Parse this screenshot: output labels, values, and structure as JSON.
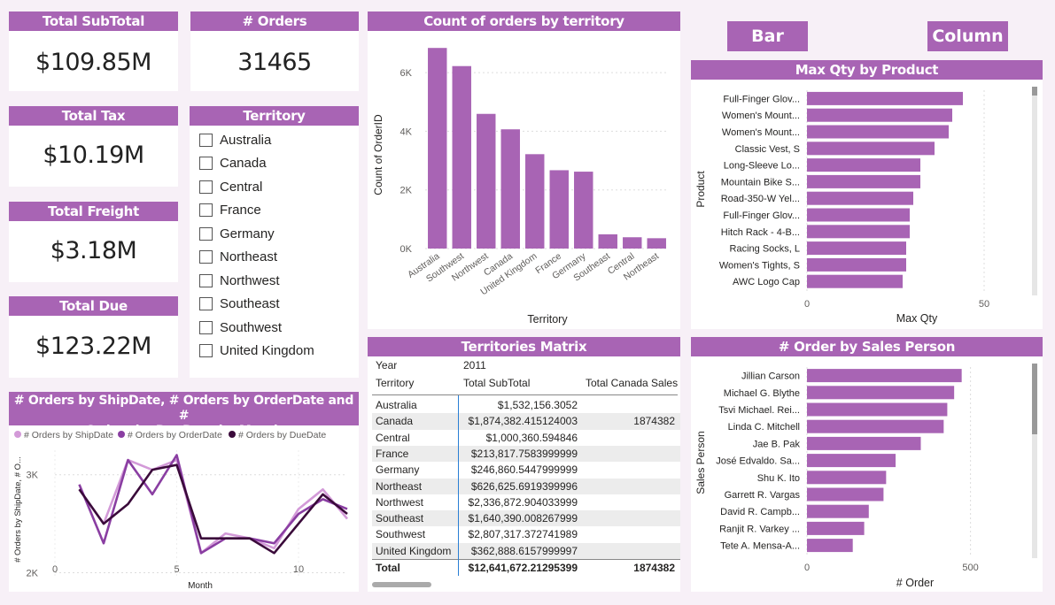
{
  "kpis": {
    "total_subtotal": {
      "title": "Total SubTotal",
      "value": "$109.85M"
    },
    "orders": {
      "title": "# Orders",
      "value": "31465"
    },
    "total_tax": {
      "title": "Total Tax",
      "value": "$10.19M"
    },
    "total_freight": {
      "title": "Total Freight",
      "value": "$3.18M"
    },
    "total_due": {
      "title": "Total Due",
      "value": "$123.22M"
    }
  },
  "territory_slicer": {
    "title": "Territory",
    "items": [
      "Australia",
      "Canada",
      "Central",
      "France",
      "Germany",
      "Northeast",
      "Northwest",
      "Southeast",
      "Southwest",
      "United Kingdom"
    ]
  },
  "buttons": {
    "bar": "Bar",
    "column": "Column"
  },
  "colors": {
    "accent": "#a864b4",
    "ship": "#d39ad8",
    "order": "#8a3ea2",
    "due": "#3a0a3a"
  },
  "orders_by_territory": {
    "title": "Count of orders by territory",
    "chart_data": {
      "type": "bar",
      "xlabel": "Territory",
      "ylabel": "Count of OrderID",
      "ylim": [
        0,
        7000
      ],
      "yticks": [
        "0K",
        "2K",
        "4K",
        "6K"
      ],
      "categories": [
        "Australia",
        "Southwest",
        "Northwest",
        "Canada",
        "United Kingdom",
        "France",
        "Germany",
        "Southeast",
        "Central",
        "Northeast"
      ],
      "values": [
        6843,
        6224,
        4594,
        4067,
        3219,
        2672,
        2623,
        486,
        385,
        352
      ]
    }
  },
  "max_qty_by_product": {
    "title": "Max Qty by Product",
    "chart_data": {
      "type": "bar",
      "ylabel": "Product",
      "xlabel": "Max Qty",
      "xlim": [
        0,
        60
      ],
      "xticks": [
        "0",
        "50"
      ],
      "categories": [
        "Full-Finger Glov...",
        "Women's Mount...",
        "Women's Mount...",
        "Classic Vest, S",
        "Long-Sleeve Lo...",
        "Mountain Bike S...",
        "Road-350-W Yel...",
        "Full-Finger Glov...",
        "Hitch Rack - 4-B...",
        "Racing Socks, L",
        "Women's Tights, S",
        "AWC Logo Cap"
      ],
      "values": [
        44,
        41,
        40,
        36,
        32,
        32,
        30,
        29,
        29,
        28,
        28,
        27
      ]
    }
  },
  "territories_matrix": {
    "title": "Territories Matrix",
    "year_label": "Year",
    "year_value": "2011",
    "col_territory": "Territory",
    "col_subtotal": "Total SubTotal",
    "col_canada": "Total Canada Sales",
    "rows": [
      {
        "territory": "Australia",
        "subtotal": "$1,532,156.3052",
        "canada": ""
      },
      {
        "territory": "Canada",
        "subtotal": "$1,874,382.415124003",
        "canada": "1874382"
      },
      {
        "territory": "Central",
        "subtotal": "$1,000,360.594846",
        "canada": ""
      },
      {
        "territory": "France",
        "subtotal": "$213,817.7583999999",
        "canada": ""
      },
      {
        "territory": "Germany",
        "subtotal": "$246,860.5447999999",
        "canada": ""
      },
      {
        "territory": "Northeast",
        "subtotal": "$626,625.6919399996",
        "canada": ""
      },
      {
        "territory": "Northwest",
        "subtotal": "$2,336,872.904033999",
        "canada": ""
      },
      {
        "territory": "Southeast",
        "subtotal": "$1,640,390.008267999",
        "canada": ""
      },
      {
        "territory": "Southwest",
        "subtotal": "$2,807,317.372741989",
        "canada": ""
      },
      {
        "territory": "United Kingdom",
        "subtotal": "$362,888.6157999997",
        "canada": ""
      }
    ],
    "total": {
      "territory": "Total",
      "subtotal": "$12,641,672.21295399",
      "canada": "1874382"
    }
  },
  "orders_by_month": {
    "title_line1": "# Orders by ShipDate, # Orders by OrderDate and #",
    "title_line2": "Orders by DueDate by Month",
    "chart_data": {
      "type": "line",
      "xlabel": "Month",
      "ylabel": "# Orders by ShipDate, # O...",
      "xlim": [
        0,
        12
      ],
      "ylim": [
        1950,
        3250
      ],
      "xticks": [
        "0",
        "5",
        "10"
      ],
      "yticks": [
        "2K",
        "3K"
      ],
      "x": [
        1,
        2,
        3,
        4,
        5,
        6,
        7,
        8,
        9,
        10,
        11,
        12
      ],
      "series": [
        {
          "name": "# Orders by ShipDate",
          "values": [
            2850,
            2500,
            3150,
            3050,
            3150,
            2200,
            2400,
            2350,
            2250,
            2650,
            2850,
            2550
          ]
        },
        {
          "name": "# Orders by OrderDate",
          "values": [
            2900,
            2300,
            3150,
            2800,
            3200,
            2200,
            2350,
            2350,
            2300,
            2600,
            2750,
            2650
          ]
        },
        {
          "name": "# Orders by DueDate",
          "values": [
            2850,
            2500,
            2700,
            3050,
            3100,
            2350,
            2350,
            2350,
            2200,
            2500,
            2800,
            2600
          ]
        }
      ]
    }
  },
  "orders_by_sales_person": {
    "title": "# Order by Sales Person",
    "chart_data": {
      "type": "bar",
      "ylabel": "Sales Person",
      "xlabel": "# Order",
      "xlim": [
        0,
        650
      ],
      "xticks": [
        "0",
        "500"
      ],
      "categories": [
        "Jillian Carson",
        "Michael G. Blythe",
        "Tsvi Michael. Rei...",
        "Linda C. Mitchell",
        "Jae B. Pak",
        "José Edvaldo. Sa...",
        "Shu K. Ito",
        "Garrett R. Vargas",
        "David R. Campb...",
        "Ranjit R. Varkey ...",
        "Tete A. Mensa-A..."
      ],
      "values": [
        473,
        450,
        429,
        418,
        348,
        271,
        242,
        234,
        189,
        175,
        140
      ]
    }
  }
}
